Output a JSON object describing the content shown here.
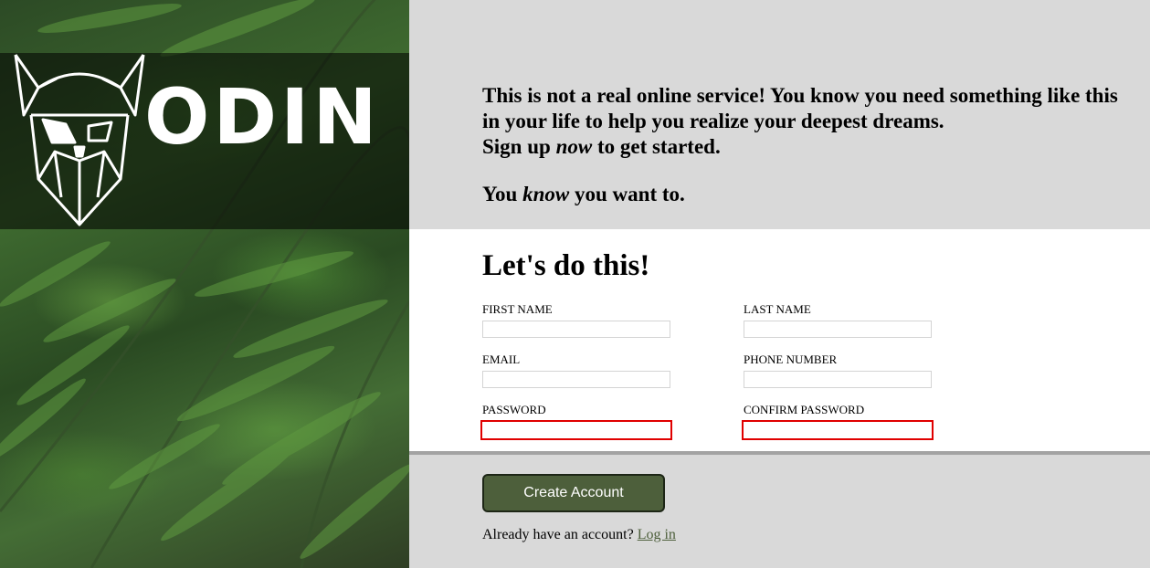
{
  "brand": {
    "name": "ODIN"
  },
  "intro": {
    "line1": "This is not a real online service! You know you need something like this in your life to help you realize your deepest dreams.",
    "line2_before": "Sign up ",
    "line2_em": "now",
    "line2_after": " to get started.",
    "line3_before": "You ",
    "line3_em": "know",
    "line3_after": " you want to."
  },
  "form": {
    "title": "Let's do this!",
    "fields": {
      "first_name": {
        "label": "FIRST NAME",
        "value": ""
      },
      "last_name": {
        "label": "LAST NAME",
        "value": ""
      },
      "email": {
        "label": "EMAIL",
        "value": ""
      },
      "phone": {
        "label": "PHONE NUMBER",
        "value": ""
      },
      "password": {
        "label": "PASSWORD",
        "value": "",
        "invalid": true
      },
      "confirm_password": {
        "label": "CONFIRM PASSWORD",
        "value": "",
        "invalid": true
      }
    }
  },
  "actions": {
    "create_label": "Create Account",
    "login_prompt": "Already have an account?",
    "login_link": "Log in"
  },
  "colors": {
    "page_bg": "#d9d9d9",
    "panel_bg": "#ffffff",
    "accent": "#4d5f3b",
    "error": "#e00000"
  },
  "icons": {
    "logo": "odin-viking-helmet-icon",
    "background": "fern-photo"
  }
}
